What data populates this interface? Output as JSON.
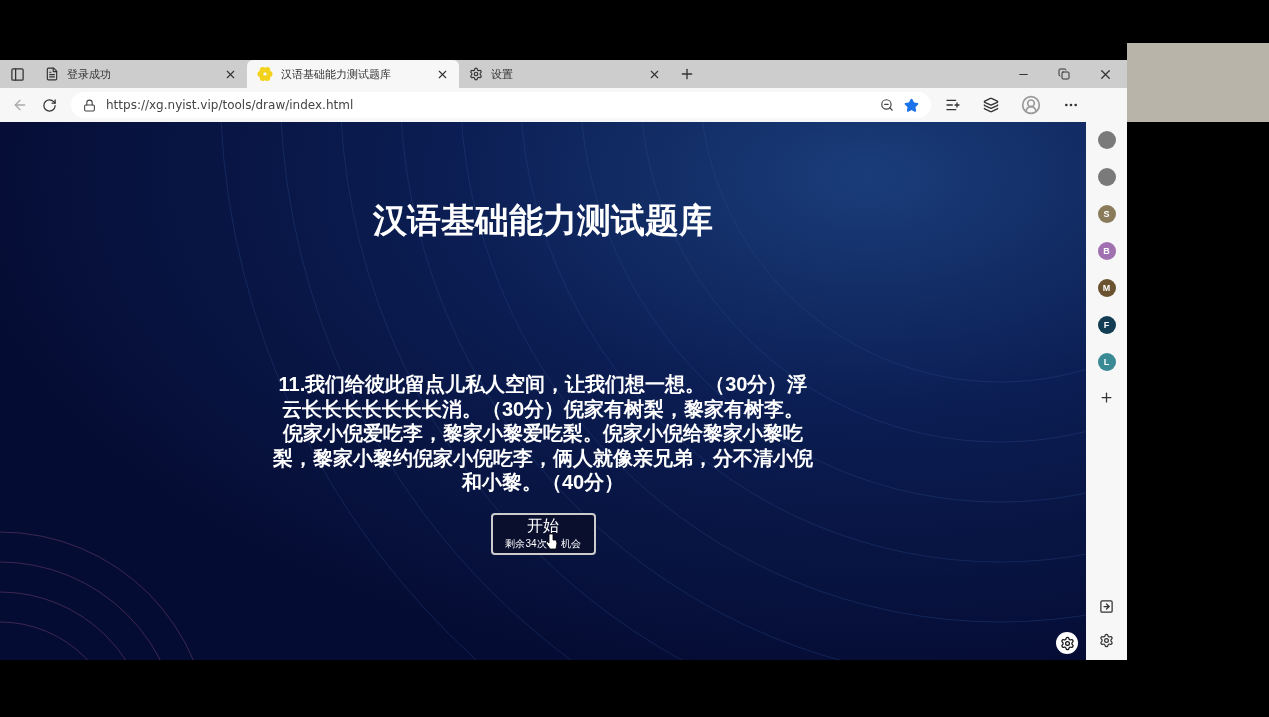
{
  "tabs": [
    {
      "title": "登录成功",
      "selected": false
    },
    {
      "title": "汉语基础能力测试题库",
      "selected": true
    },
    {
      "title": "设置",
      "selected": false
    }
  ],
  "address": {
    "url": "https://xg.nyist.vip/tools/draw/index.html",
    "favorite": true
  },
  "sidebar": {
    "items": [
      {
        "color": "#7a7a7a"
      },
      {
        "color": "#7a7a7a"
      },
      {
        "letter": "S",
        "color": "#8a7c5a"
      },
      {
        "letter": "B",
        "color": "#a070b0"
      },
      {
        "letter": "M",
        "color": "#6b5230"
      },
      {
        "letter": "F",
        "color": "#123d52"
      },
      {
        "letter": "L",
        "color": "#3a8a96"
      }
    ]
  },
  "page": {
    "title": "汉语基础能力测试题库",
    "question": "11.我们给彼此留点儿私人空间，让我们想一想。（30分）浮云长长长长长长长消。（30分）倪家有树梨，黎家有树李。倪家小倪爱吃李，黎家小黎爱吃梨。倪家小倪给黎家小黎吃梨，黎家小黎约倪家小倪吃李，俩人就像亲兄弟，分不清小倪和小黎。（40分）",
    "start_button": {
      "label": "开始",
      "note_before_cursor": "剩余34次",
      "note_after_cursor": "机会"
    }
  }
}
